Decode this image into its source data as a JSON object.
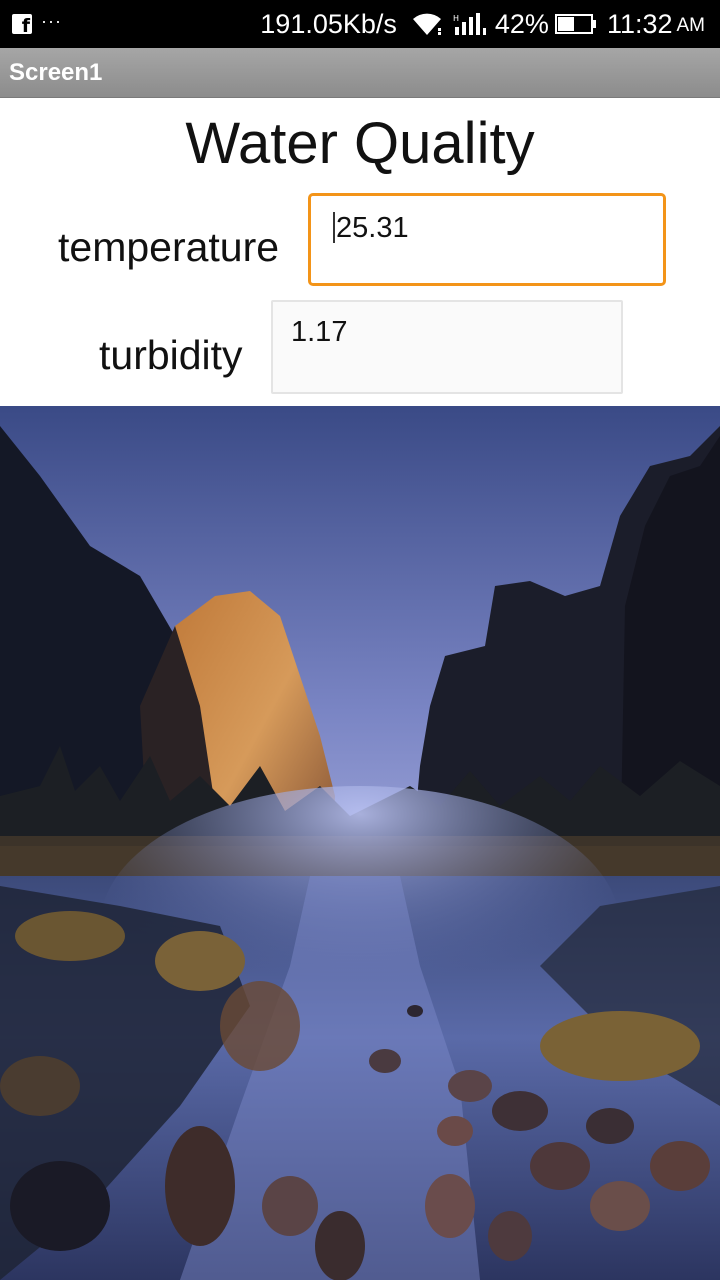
{
  "status_bar": {
    "app_notification_icon": "facebook-icon",
    "more_notifications": "···",
    "network_speed": "191.05Kb/s",
    "battery_percent": "42%",
    "time": "11:32",
    "ampm": "AM"
  },
  "app_bar": {
    "title": "Screen1"
  },
  "main": {
    "heading": "Water Quality",
    "fields": [
      {
        "label": "temperature",
        "value": "25.31",
        "focused": true
      },
      {
        "label": "turbidity",
        "value": "1.17",
        "focused": false
      }
    ],
    "image": {
      "subject": "mountain-valley-river-landscape"
    }
  },
  "colors": {
    "focus_border": "#f39418",
    "app_bar": "#9a9a9a",
    "status_bar": "#000000"
  }
}
